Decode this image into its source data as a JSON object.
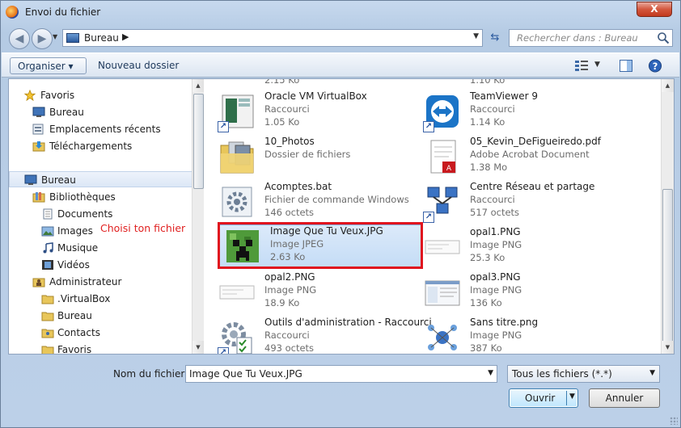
{
  "window": {
    "title": "Envoi du fichier",
    "close_label": "X"
  },
  "address": {
    "crumb": "Bureau",
    "arrow": "▶",
    "dropdown": "▼"
  },
  "search": {
    "placeholder": "Rechercher dans : Bureau"
  },
  "toolbar": {
    "organiser": "Organiser ▾",
    "new_folder": "Nouveau dossier",
    "view_dropdown": "▼"
  },
  "nav_pane": {
    "items": [
      {
        "label": "Favoris",
        "icon": "star-icon"
      },
      {
        "label": "Bureau",
        "icon": "desktop-icon"
      },
      {
        "label": "Emplacements récents",
        "icon": "recent-places-icon"
      },
      {
        "label": "Téléchargements",
        "icon": "downloads-icon"
      },
      {
        "label": "Bureau",
        "icon": "desktop-icon"
      },
      {
        "label": "Bibliothèques",
        "icon": "libraries-icon"
      },
      {
        "label": "Documents",
        "icon": "documents-icon"
      },
      {
        "label": "Images",
        "icon": "images-icon"
      },
      {
        "label": "Musique",
        "icon": "music-icon"
      },
      {
        "label": "Vidéos",
        "icon": "videos-icon"
      },
      {
        "label": "Administrateur",
        "icon": "user-folder-icon"
      },
      {
        "label": ".VirtualBox",
        "icon": "folder-icon"
      },
      {
        "label": "Bureau",
        "icon": "folder-icon"
      },
      {
        "label": "Contacts",
        "icon": "contacts-icon"
      },
      {
        "label": "Favoris",
        "icon": "folder-icon"
      }
    ],
    "hint": "Choisi ton fichier"
  },
  "files": {
    "top_partial_left": "2.15 Ko",
    "top_partial_right": "1.10 Ko",
    "items": [
      {
        "name": "Oracle VM VirtualBox",
        "type": "Raccourci",
        "size": "1.05 Ko"
      },
      {
        "name": "TeamViewer 9",
        "type": "Raccourci",
        "size": "1.14 Ko"
      },
      {
        "name": "10_Photos",
        "type": "Dossier de fichiers",
        "size": ""
      },
      {
        "name": "05_Kevin_DeFigueiredo.pdf",
        "type": "Adobe Acrobat Document",
        "size": "1.38 Mo"
      },
      {
        "name": "Acomptes.bat",
        "type": "Fichier de commande Windows",
        "size": "146 octets"
      },
      {
        "name": "Centre Réseau et partage",
        "type": "Raccourci",
        "size": "517 octets"
      },
      {
        "name": "Image Que Tu Veux.JPG",
        "type": "Image JPEG",
        "size": "2.63 Ko"
      },
      {
        "name": "opal1.PNG",
        "type": "Image PNG",
        "size": "25.3 Ko"
      },
      {
        "name": "opal2.PNG",
        "type": "Image PNG",
        "size": "18.9 Ko"
      },
      {
        "name": "opal3.PNG",
        "type": "Image PNG",
        "size": "136 Ko"
      },
      {
        "name": "Outils d'administration - Raccourci",
        "type": "Raccourci",
        "size": "493 octets"
      },
      {
        "name": "Sans titre.png",
        "type": "Image PNG",
        "size": "387 Ko"
      }
    ]
  },
  "footer": {
    "filename_label": "Nom du fichier :",
    "filename_value": "Image Que Tu Veux.JPG",
    "filter_value": "Tous les fichiers (*.*)",
    "open_label": "Ouvrir",
    "cancel_label": "Annuler",
    "dropdown": "▼"
  },
  "colors": {
    "highlight": "#e0141e",
    "accent": "#3c7fb1",
    "hint": "#e02020"
  }
}
